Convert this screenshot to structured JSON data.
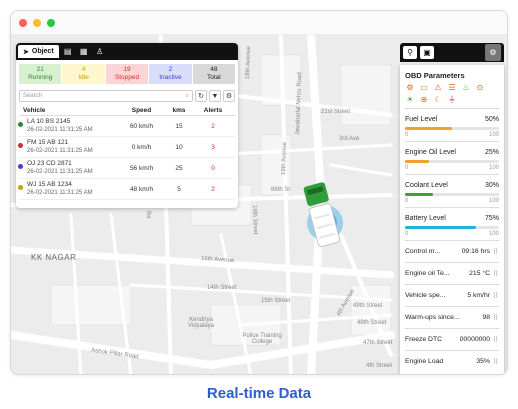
{
  "object_panel": {
    "tab_label": "Object",
    "stats": [
      {
        "count": "21",
        "label": "Running",
        "bg": "#d7f0cf",
        "color": "#2e8b2e"
      },
      {
        "count": "4",
        "label": "Idle",
        "bg": "#fdf6cf",
        "color": "#c8a000"
      },
      {
        "count": "19",
        "label": "Stopped",
        "bg": "#fbd5d5",
        "color": "#d62b2b"
      },
      {
        "count": "2",
        "label": "Inactive",
        "bg": "#d9dcfb",
        "color": "#3a42d6"
      },
      {
        "count": "48",
        "label": "Total",
        "bg": "#d9d9d9",
        "color": "#222222"
      }
    ],
    "search_placeholder": "Search",
    "columns": {
      "vehicle": "Vehicle",
      "speed": "Speed",
      "kms": "kms",
      "alerts": "Alerts"
    },
    "rows": [
      {
        "name": "LA 10 BS 2145",
        "date": "26-02-2021 11:31:25 AM",
        "speed": "60 km/h",
        "kms": "15",
        "alerts": "2",
        "dot": "#2e8b2e"
      },
      {
        "name": "FM 15 AB 121",
        "date": "26-02-2021 11:31:25 AM",
        "speed": "0 km/h",
        "kms": "10",
        "alerts": "3",
        "dot": "#d62b2b"
      },
      {
        "name": "OJ 23 CD 2871",
        "date": "26-02-2021 11:31:25 AM",
        "speed": "56 km/h",
        "kms": "25",
        "alerts": "0",
        "dot": "#3a42d6"
      },
      {
        "name": "WJ 15 AB 1234",
        "date": "26-02-2021 11:31:25 AM",
        "speed": "48 km/h",
        "kms": "5",
        "alerts": "2",
        "dot": "#c8a000"
      }
    ]
  },
  "obd_panel": {
    "title": "OBD Parameters",
    "gauges": [
      {
        "label": "Fuel Level",
        "value": "50%",
        "fraction": 0.5,
        "color": "#f0a12b",
        "min": "0",
        "max": "100"
      },
      {
        "label": "Engine Oil Level",
        "value": "25%",
        "fraction": 0.25,
        "color": "#f0a12b",
        "min": "0",
        "max": "100"
      },
      {
        "label": "Coolant Level",
        "value": "30%",
        "fraction": 0.3,
        "color": "#3aa32b",
        "min": "0",
        "max": "100"
      },
      {
        "label": "Battery Level",
        "value": "75%",
        "fraction": 0.75,
        "color": "#1fb3e0",
        "min": "0",
        "max": "100"
      }
    ],
    "params": [
      {
        "label": "Control m...",
        "value": "09:16 hrs"
      },
      {
        "label": "Engine oil Te...",
        "value": "215 °C"
      },
      {
        "label": "Vehicle spe...",
        "value": "5 km/hr"
      },
      {
        "label": "Warm-ups since...",
        "value": "98"
      },
      {
        "label": "Freeze DTC",
        "value": "00000000"
      },
      {
        "label": "Engine Load",
        "value": "35%"
      }
    ]
  },
  "map_labels": {
    "kk_nagar": "KK NAGAR",
    "ashok_pillar_road": "Ashok Pillar Road",
    "jawaharlal_nehru_road": "Jawaharlal Nehru Road",
    "street_18th_a": "18th Avenue",
    "street_19th": "19th Avenue",
    "street_21st": "21st Street",
    "street_3rd": "3rd Ave",
    "street_86th": "86th St",
    "street_18th": "18th Street",
    "street_16th": "16th Avenue",
    "street_4th": "4th Avenue",
    "street_49th": "49th Street",
    "street_48th": "48th Street",
    "street_47th": "47th Street",
    "street_4th_b": "4th Street",
    "street_14th": "14th Street",
    "street_15th": "15th Street",
    "ba": "Ba",
    "kendriya_vidyalaya": "Kendriya Vidyalaya",
    "police_training_college": "Police Training College"
  },
  "caption": "Real-time Data"
}
